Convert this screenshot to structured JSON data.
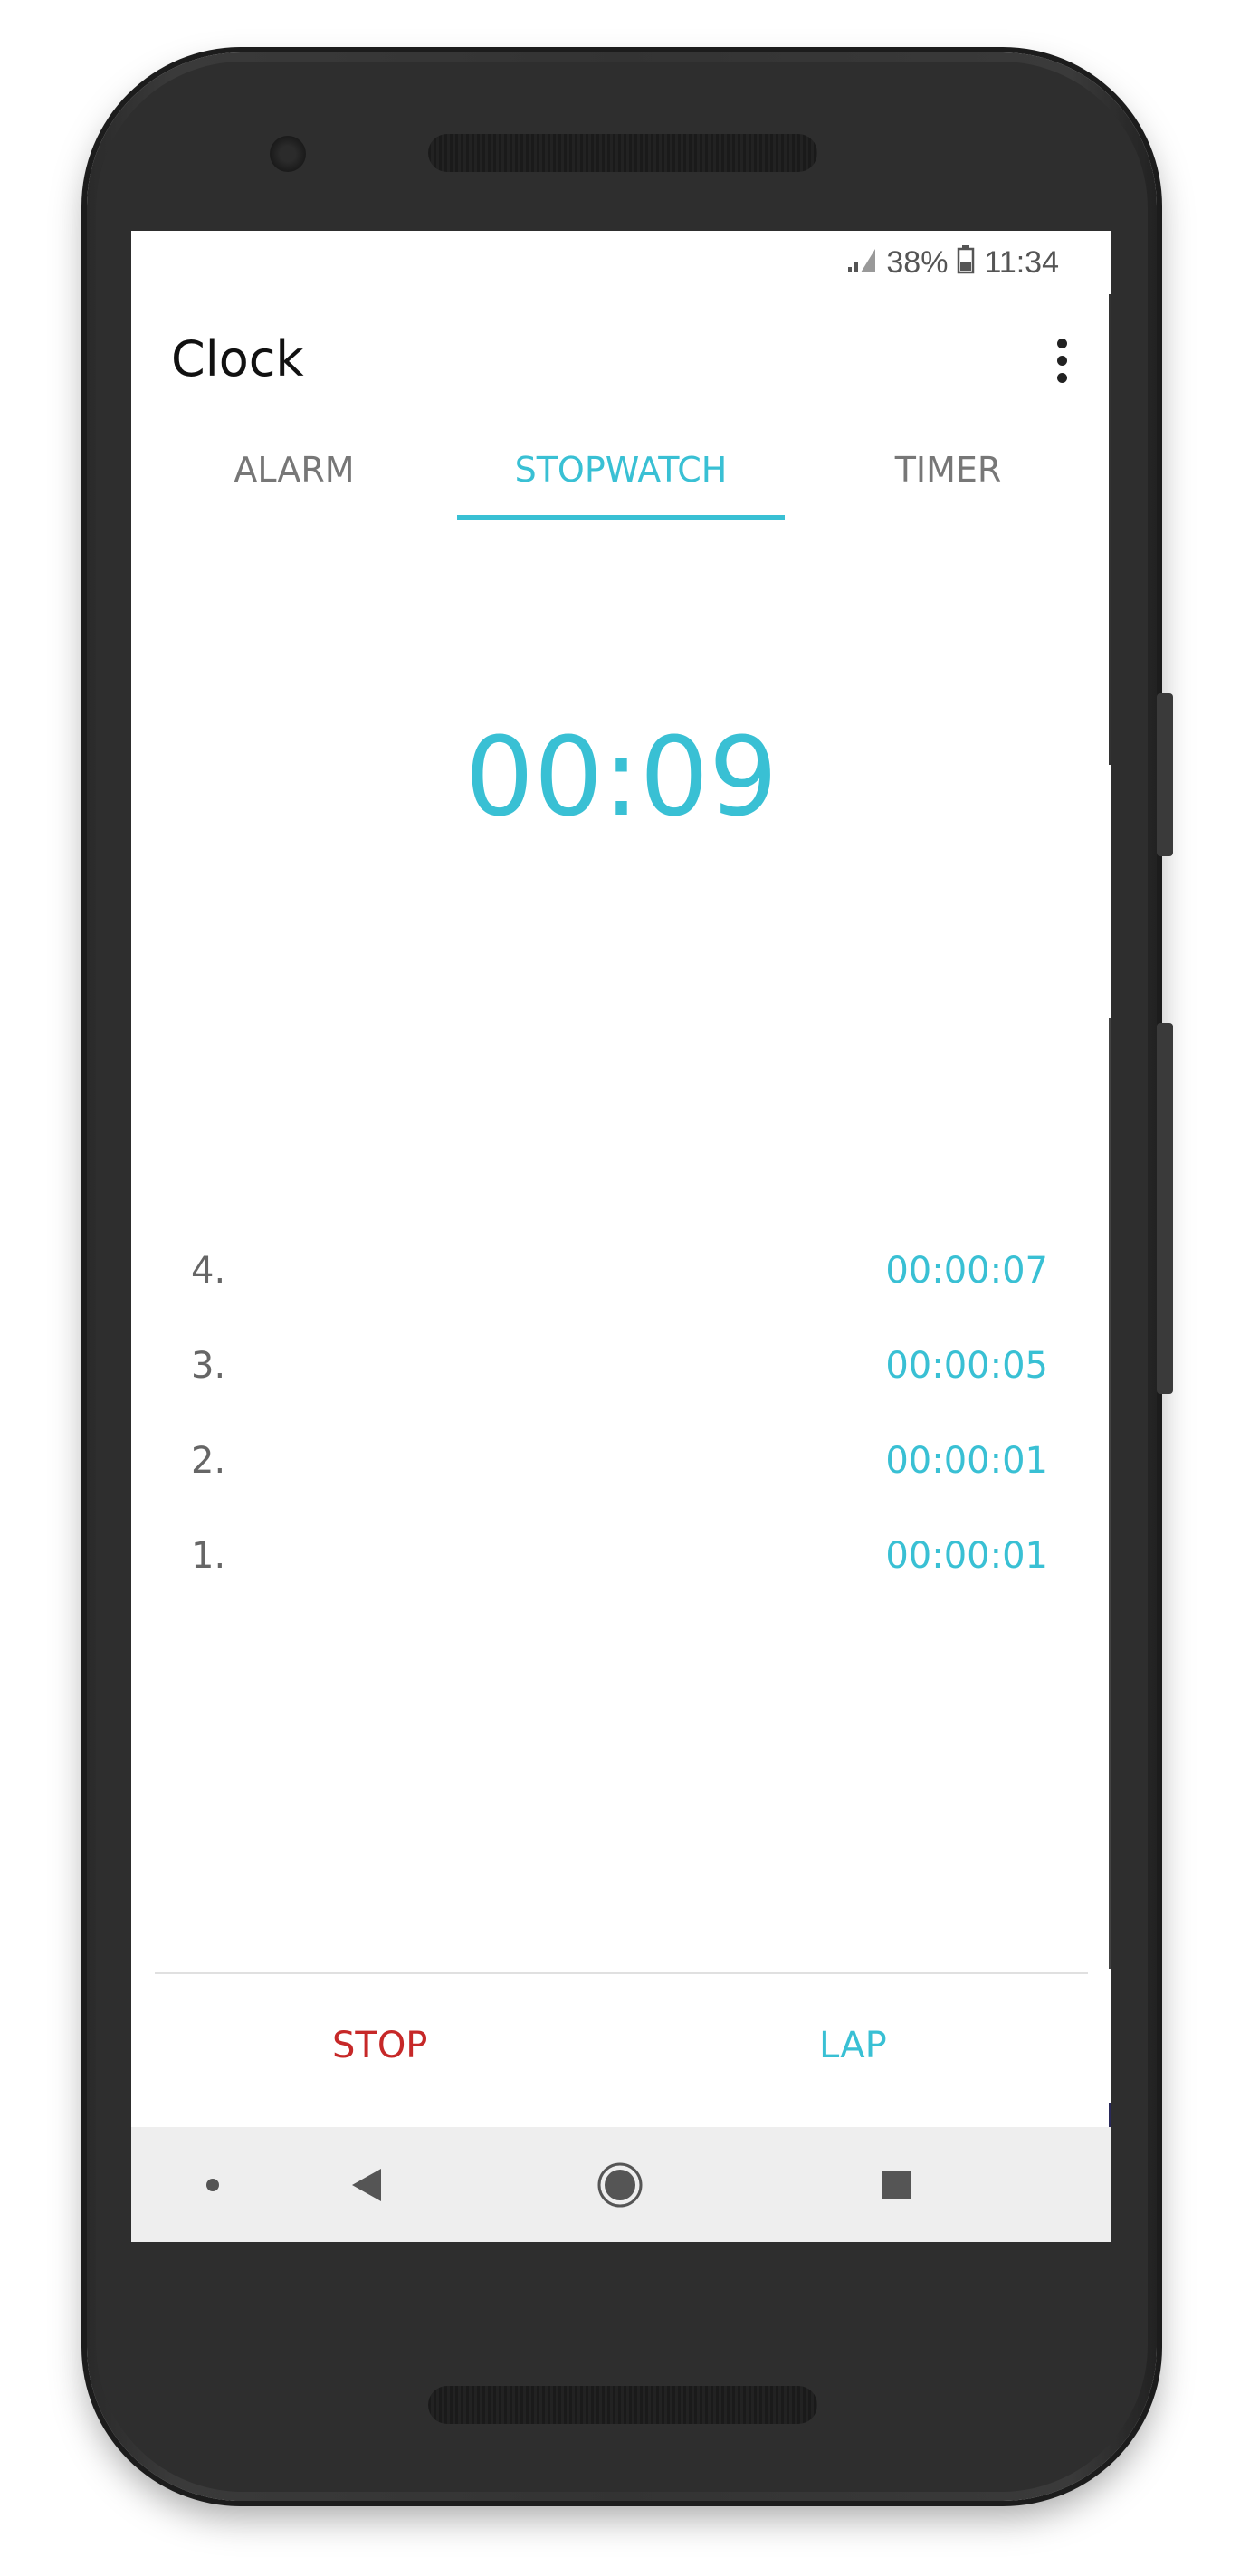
{
  "status_bar": {
    "battery_percent": "38%",
    "time": "11:34",
    "signal_icon": "signal-icon",
    "battery_icon": "battery-icon"
  },
  "app_bar": {
    "title": "Clock",
    "menu_icon": "more-vert-icon"
  },
  "tabs": [
    {
      "label": "ALARM",
      "active": false
    },
    {
      "label": "STOPWATCH",
      "active": true
    },
    {
      "label": "TIMER",
      "active": false
    }
  ],
  "stopwatch": {
    "elapsed": "00:09"
  },
  "laps": [
    {
      "number": "4.",
      "time": "00:00:07"
    },
    {
      "number": "3.",
      "time": "00:00:05"
    },
    {
      "number": "2.",
      "time": "00:00:01"
    },
    {
      "number": "1.",
      "time": "00:00:01"
    }
  ],
  "actions": {
    "stop_label": "STOP",
    "lap_label": "LAP"
  },
  "nav_bar": {
    "items": [
      "dot-icon",
      "back-icon",
      "home-icon",
      "recents-icon"
    ]
  },
  "colors": {
    "accent": "#39c0d4",
    "stop": "#c62828",
    "text_secondary": "#777777",
    "navbar_bg": "#eeeeee",
    "device_body": "#2e2e2e"
  }
}
